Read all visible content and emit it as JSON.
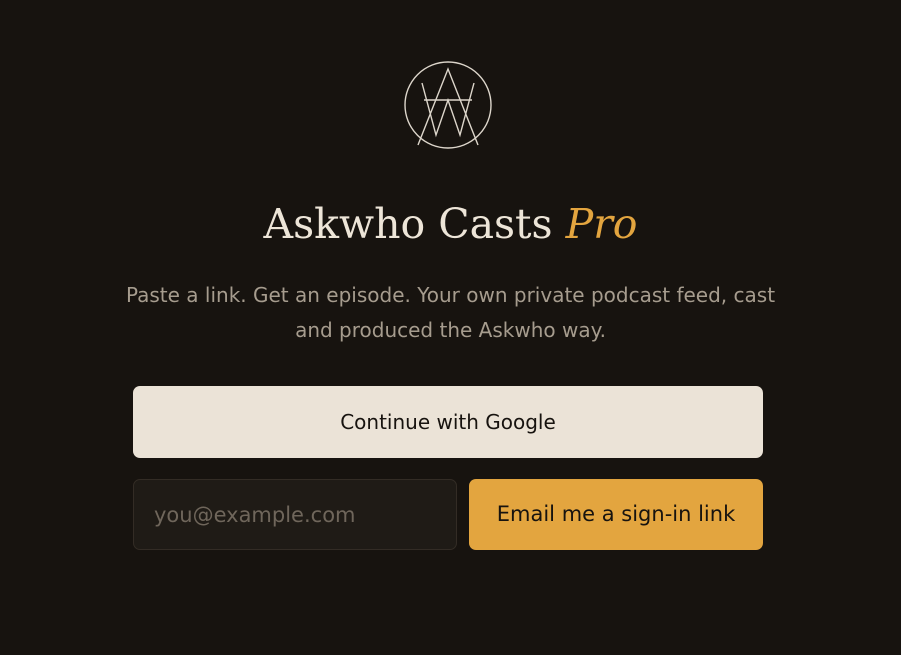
{
  "brand": {
    "logo_icon": "askwho-monogram-icon",
    "title_main": "Askwho Casts",
    "title_accent": "Pro",
    "tagline": "Paste a link. Get an episode. Your own private podcast feed, cast and produced the Askwho way."
  },
  "auth": {
    "google_label": "Continue with Google",
    "email_placeholder": "you@example.com",
    "email_value": "",
    "email_button_label": "Email me a sign-in link"
  },
  "colors": {
    "background": "#17130f",
    "accent": "#e3a53f",
    "primary_button": "#ebe3d7",
    "title_text": "#ede5d8",
    "muted_text": "#a69c8e"
  }
}
